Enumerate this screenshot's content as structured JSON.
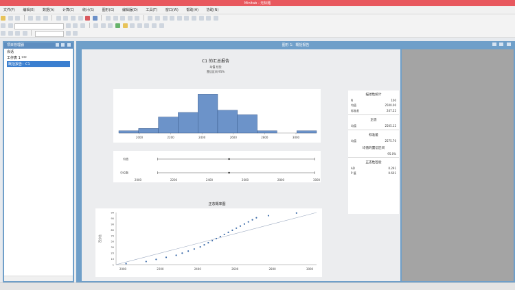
{
  "window": {
    "title": "Minitab - 无标题"
  },
  "menu": [
    "文件(F)",
    "编辑(E)",
    "数据(A)",
    "计算(C)",
    "统计(S)",
    "图形(G)",
    "编辑器(D)",
    "工具(T)",
    "窗口(W)",
    "帮助(H)",
    "协助(N)"
  ],
  "left_panel": {
    "title": "项目管理器",
    "items": [
      "会话",
      "工作表 1 ***",
      "概括报告：C1"
    ]
  },
  "graph": {
    "window_title": "图形 1：概括报告",
    "title": "C1 的汇总报告",
    "subtitle1": "均值 检验",
    "subtitle2": "置信区间 95%"
  },
  "stats": {
    "s1_title": "描述性统计",
    "s1_rows": [
      [
        "N",
        "100"
      ],
      [
        "均值",
        "2500.00"
      ],
      [
        "标准差",
        "247.22"
      ]
    ],
    "s2_title": "正态",
    "s2_rows": [
      [
        "均值",
        "2505.12"
      ]
    ],
    "s3_title": "标准差",
    "s3_rows": [
      [
        "均值",
        "2575.70"
      ]
    ],
    "s4_title": "均值的置信区间",
    "s4_rows": [
      [
        "",
        "95.0%"
      ]
    ],
    "s5_title": "正态性检验",
    "s5_rows": [
      [
        "AD",
        "0.291"
      ],
      [
        "P 值",
        "0.601"
      ]
    ]
  },
  "prob_title": "正态概率图",
  "chart_data": [
    {
      "type": "bar",
      "categories": [
        "2000",
        "2100",
        "2200",
        "2300",
        "2400",
        "2500",
        "2600",
        "2700",
        "2800",
        "2900"
      ],
      "values": [
        1,
        2,
        7,
        9,
        17,
        10,
        8,
        1,
        0,
        1
      ],
      "xticks": [
        "2000",
        "2200",
        "2400",
        "2600",
        "2800",
        "3000"
      ],
      "ylim": [
        0,
        18
      ],
      "color": "#6c93c9"
    },
    {
      "type": "interval",
      "labels": [
        "均值",
        "中位数"
      ],
      "xlim": [
        2000,
        3000
      ],
      "xticks": [
        "2000",
        "2200",
        "2400",
        "2600",
        "2800",
        "3000"
      ],
      "intervals": [
        {
          "name": "均值",
          "low": 2110,
          "mid": 2510,
          "high": 2990
        },
        {
          "name": "中位数",
          "low": 2110,
          "mid": 2510,
          "high": 2990
        }
      ]
    },
    {
      "type": "scatter",
      "title": "正态概率图",
      "ylabel": "百分比",
      "xlim": [
        2000,
        3000
      ],
      "xticks": [
        "2000",
        "2200",
        "2400",
        "2600",
        "2800",
        "3000"
      ],
      "ylim": [
        0,
        100
      ],
      "yticks": [
        "1",
        "10",
        "20",
        "30",
        "50",
        "70",
        "80",
        "90",
        "95",
        "99"
      ],
      "x": [
        2050,
        2150,
        2200,
        2250,
        2300,
        2330,
        2360,
        2390,
        2420,
        2440,
        2460,
        2480,
        2500,
        2520,
        2540,
        2560,
        2580,
        2600,
        2620,
        2640,
        2660,
        2680,
        2700,
        2760,
        2900
      ],
      "y": [
        2,
        6,
        10,
        14,
        18,
        22,
        26,
        30,
        34,
        38,
        42,
        46,
        50,
        54,
        58,
        62,
        66,
        70,
        74,
        78,
        82,
        86,
        90,
        94,
        99
      ],
      "color": "#3a6aa8"
    }
  ]
}
